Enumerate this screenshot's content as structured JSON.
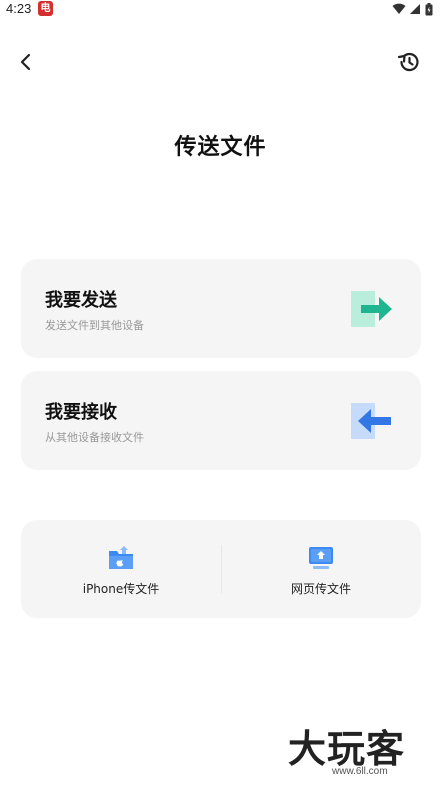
{
  "status_bar": {
    "time": "4:23",
    "badge": "电",
    "icons": [
      "wifi-icon",
      "signal-icon",
      "battery-icon"
    ]
  },
  "header": {
    "back_icon": "chevron-left-icon",
    "history_icon": "history-icon",
    "title": "传送文件"
  },
  "cards": {
    "send": {
      "title": "我要发送",
      "subtitle": "发送文件到其他设备",
      "icon": "arrow-right-icon",
      "accent_color": "#1fb58e"
    },
    "receive": {
      "title": "我要接收",
      "subtitle": "从其他设备接收文件",
      "icon": "arrow-left-icon",
      "accent_color": "#3377e6"
    }
  },
  "tools": {
    "iphone": {
      "label": "iPhone传文件",
      "icon": "iphone-transfer-icon"
    },
    "web": {
      "label": "网页传文件",
      "icon": "web-transfer-icon"
    },
    "accent_color": "#3d8bf2"
  },
  "watermark": {
    "text": "大玩客",
    "url": "www.6ll.com"
  },
  "colors": {
    "card_background": "#f5f5f5",
    "subtitle": "#999999",
    "text": "#111111"
  }
}
